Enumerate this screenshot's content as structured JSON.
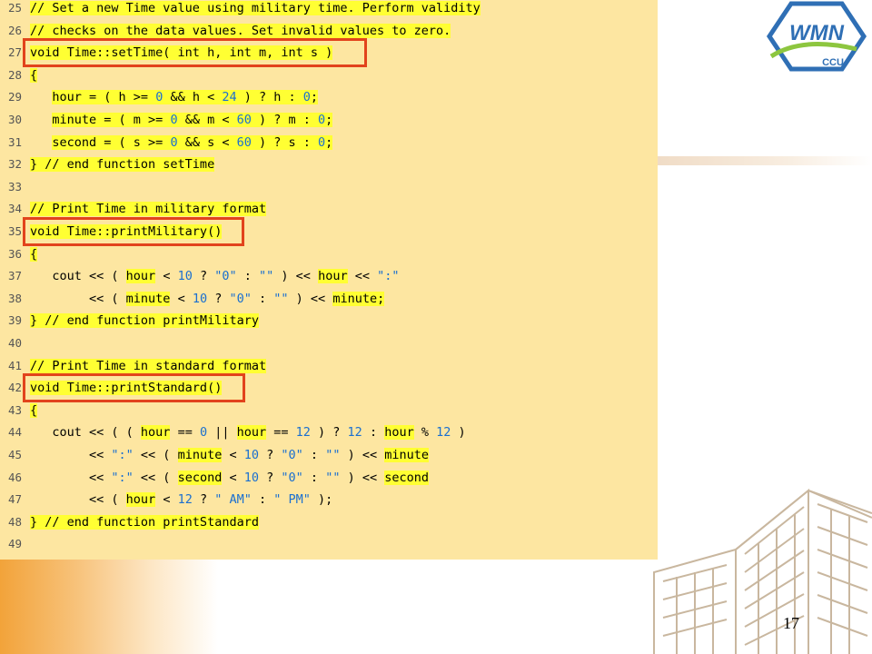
{
  "logo": {
    "main_text": "WMN",
    "sub_text": "CCU"
  },
  "page_number": "17",
  "code_lines": [
    {
      "num": "25",
      "segments": [
        {
          "t": "// Set a new Time value using military time. Perform validity",
          "c": "hl"
        }
      ]
    },
    {
      "num": "26",
      "segments": [
        {
          "t": "// checks on the data values. Set invalid values to zero.",
          "c": "hl"
        }
      ]
    },
    {
      "num": "27",
      "segments": [
        {
          "t": "void Time::setTime( int h, int m, int s )",
          "c": "hl"
        }
      ]
    },
    {
      "num": "28",
      "segments": [
        {
          "t": "{",
          "c": "hl"
        }
      ]
    },
    {
      "num": "29",
      "segments": [
        {
          "t": "   ",
          "c": ""
        },
        {
          "t": "hour = ( h >= ",
          "c": "hl"
        },
        {
          "t": "0",
          "c": "hl num"
        },
        {
          "t": " && h < ",
          "c": "hl"
        },
        {
          "t": "24",
          "c": "hl num"
        },
        {
          "t": " ) ? h : ",
          "c": "hl"
        },
        {
          "t": "0",
          "c": "hl num"
        },
        {
          "t": ";",
          "c": "hl"
        }
      ]
    },
    {
      "num": "30",
      "segments": [
        {
          "t": "   ",
          "c": ""
        },
        {
          "t": "minute = ( m >= ",
          "c": "hl"
        },
        {
          "t": "0",
          "c": "hl num"
        },
        {
          "t": " && m < ",
          "c": "hl"
        },
        {
          "t": "60",
          "c": "hl num"
        },
        {
          "t": " ) ? m : ",
          "c": "hl"
        },
        {
          "t": "0",
          "c": "hl num"
        },
        {
          "t": ";",
          "c": "hl"
        }
      ]
    },
    {
      "num": "31",
      "segments": [
        {
          "t": "   ",
          "c": ""
        },
        {
          "t": "second = ( s >= ",
          "c": "hl"
        },
        {
          "t": "0",
          "c": "hl num"
        },
        {
          "t": " && s < ",
          "c": "hl"
        },
        {
          "t": "60",
          "c": "hl num"
        },
        {
          "t": " ) ? s : ",
          "c": "hl"
        },
        {
          "t": "0",
          "c": "hl num"
        },
        {
          "t": ";",
          "c": "hl"
        }
      ]
    },
    {
      "num": "32",
      "segments": [
        {
          "t": "} // end function setTime",
          "c": "hl"
        }
      ]
    },
    {
      "num": "33",
      "segments": []
    },
    {
      "num": "34",
      "segments": [
        {
          "t": "// Print Time in military format",
          "c": "hl"
        }
      ]
    },
    {
      "num": "35",
      "segments": [
        {
          "t": "void Time::printMilitary()",
          "c": "hl"
        }
      ]
    },
    {
      "num": "36",
      "segments": [
        {
          "t": "{",
          "c": "hl"
        }
      ]
    },
    {
      "num": "37",
      "segments": [
        {
          "t": "   cout << ( ",
          "c": ""
        },
        {
          "t": "hour",
          "c": "hl"
        },
        {
          "t": " < ",
          "c": ""
        },
        {
          "t": "10",
          "c": "num"
        },
        {
          "t": " ? ",
          "c": ""
        },
        {
          "t": "\"0\"",
          "c": "str"
        },
        {
          "t": " : ",
          "c": ""
        },
        {
          "t": "\"\"",
          "c": "str"
        },
        {
          "t": " ) << ",
          "c": ""
        },
        {
          "t": "hour",
          "c": "hl"
        },
        {
          "t": " << ",
          "c": ""
        },
        {
          "t": "\":\"",
          "c": "str"
        }
      ]
    },
    {
      "num": "38",
      "segments": [
        {
          "t": "        << ( ",
          "c": ""
        },
        {
          "t": "minute",
          "c": "hl"
        },
        {
          "t": " < ",
          "c": ""
        },
        {
          "t": "10",
          "c": "num"
        },
        {
          "t": " ? ",
          "c": ""
        },
        {
          "t": "\"0\"",
          "c": "str"
        },
        {
          "t": " : ",
          "c": ""
        },
        {
          "t": "\"\"",
          "c": "str"
        },
        {
          "t": " ) << ",
          "c": ""
        },
        {
          "t": "minute;",
          "c": "hl"
        }
      ]
    },
    {
      "num": "39",
      "segments": [
        {
          "t": "} // end function printMilitary",
          "c": "hl"
        }
      ]
    },
    {
      "num": "40",
      "segments": []
    },
    {
      "num": "41",
      "segments": [
        {
          "t": "// Print Time in standard format",
          "c": "hl"
        }
      ]
    },
    {
      "num": "42",
      "segments": [
        {
          "t": "void Time::printStandard()",
          "c": "hl"
        }
      ]
    },
    {
      "num": "43",
      "segments": [
        {
          "t": "{",
          "c": "hl"
        }
      ]
    },
    {
      "num": "44",
      "segments": [
        {
          "t": "   cout << ( ( ",
          "c": ""
        },
        {
          "t": "hour",
          "c": "hl"
        },
        {
          "t": " == ",
          "c": ""
        },
        {
          "t": "0",
          "c": "num"
        },
        {
          "t": " || ",
          "c": ""
        },
        {
          "t": "hour",
          "c": "hl"
        },
        {
          "t": " == ",
          "c": ""
        },
        {
          "t": "12",
          "c": "num"
        },
        {
          "t": " ) ? ",
          "c": ""
        },
        {
          "t": "12",
          "c": "num"
        },
        {
          "t": " : ",
          "c": ""
        },
        {
          "t": "hour",
          "c": "hl"
        },
        {
          "t": " % ",
          "c": ""
        },
        {
          "t": "12",
          "c": "num"
        },
        {
          "t": " )",
          "c": ""
        }
      ]
    },
    {
      "num": "45",
      "segments": [
        {
          "t": "        << ",
          "c": ""
        },
        {
          "t": "\":\"",
          "c": "str"
        },
        {
          "t": " << ( ",
          "c": ""
        },
        {
          "t": "minute",
          "c": "hl"
        },
        {
          "t": " < ",
          "c": ""
        },
        {
          "t": "10",
          "c": "num"
        },
        {
          "t": " ? ",
          "c": ""
        },
        {
          "t": "\"0\"",
          "c": "str"
        },
        {
          "t": " : ",
          "c": ""
        },
        {
          "t": "\"\"",
          "c": "str"
        },
        {
          "t": " ) << ",
          "c": ""
        },
        {
          "t": "minute",
          "c": "hl"
        }
      ]
    },
    {
      "num": "46",
      "segments": [
        {
          "t": "        << ",
          "c": ""
        },
        {
          "t": "\":\"",
          "c": "str"
        },
        {
          "t": " << ( ",
          "c": ""
        },
        {
          "t": "second",
          "c": "hl"
        },
        {
          "t": " < ",
          "c": ""
        },
        {
          "t": "10",
          "c": "num"
        },
        {
          "t": " ? ",
          "c": ""
        },
        {
          "t": "\"0\"",
          "c": "str"
        },
        {
          "t": " : ",
          "c": ""
        },
        {
          "t": "\"\"",
          "c": "str"
        },
        {
          "t": " ) << ",
          "c": ""
        },
        {
          "t": "second",
          "c": "hl"
        }
      ]
    },
    {
      "num": "47",
      "segments": [
        {
          "t": "        << ( ",
          "c": ""
        },
        {
          "t": "hour",
          "c": "hl"
        },
        {
          "t": " < ",
          "c": ""
        },
        {
          "t": "12",
          "c": "num"
        },
        {
          "t": " ? ",
          "c": ""
        },
        {
          "t": "\" AM\"",
          "c": "str"
        },
        {
          "t": " : ",
          "c": ""
        },
        {
          "t": "\" PM\"",
          "c": "str"
        },
        {
          "t": " );",
          "c": ""
        }
      ]
    },
    {
      "num": "48",
      "segments": [
        {
          "t": "} // end function printStandard",
          "c": "hl"
        }
      ]
    },
    {
      "num": "49",
      "segments": []
    }
  ],
  "colors": {
    "panel_bg": "#fde6a1",
    "highlight": "#ffff33",
    "literal": "#1a6fd0",
    "box_border": "#e2431c",
    "accent_orange": "#f2a33a"
  }
}
